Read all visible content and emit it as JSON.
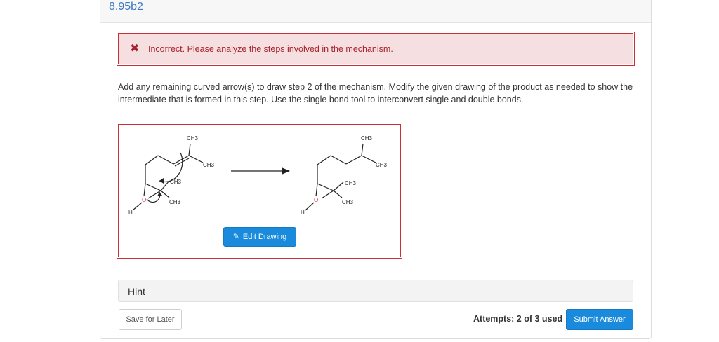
{
  "header": {
    "question_id": "8.95b2"
  },
  "alert": {
    "icon": "x-icon",
    "message": "Incorrect. Please analyze the steps involved in the mechanism.",
    "color": "#a8232b"
  },
  "instructions": "Add any remaining curved arrow(s) to draw step 2 of the mechanism. Modify the given drawing of the product as needed to show the intermediate that is formed in this step. Use the single bond tool to interconvert single and double bonds.",
  "drawing": {
    "reactant_labels": [
      "CH3",
      "CH3",
      "CH3",
      "CH3",
      "H",
      "O"
    ],
    "product_labels": [
      "CH3",
      "CH3",
      "CH3",
      "CH3",
      "H",
      "O"
    ],
    "edit_button_label": "Edit Drawing",
    "edit_button_icon": "pencil-icon"
  },
  "hint_label": "Hint",
  "footer": {
    "save_label": "Save for Later",
    "attempts_text": "Attempts: 2 of 3 used",
    "submit_label": "Submit Answer"
  },
  "colors": {
    "accent": "#1a8bdc",
    "error": "#c9303a",
    "error_bg": "#f6dfe0"
  }
}
